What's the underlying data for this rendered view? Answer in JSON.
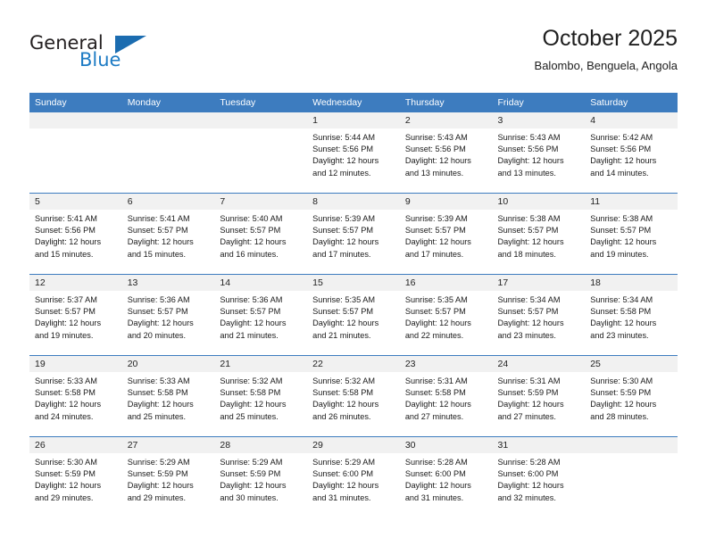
{
  "brand": {
    "word_general": "General",
    "word_blue": "Blue",
    "logo_icon": "triangle-icon"
  },
  "header": {
    "title": "October 2025",
    "subtitle": "Balombo, Benguela, Angola"
  },
  "colors": {
    "header_blue": "#3d7cbf",
    "daynum_gray": "#f1f1f1",
    "brand_blue": "#1d7bc4",
    "text": "#1a1a1a"
  },
  "weekday_headers": [
    "Sunday",
    "Monday",
    "Tuesday",
    "Wednesday",
    "Thursday",
    "Friday",
    "Saturday"
  ],
  "weeks": [
    [
      {
        "day": "",
        "details": ""
      },
      {
        "day": "",
        "details": ""
      },
      {
        "day": "",
        "details": ""
      },
      {
        "day": "1",
        "details": "Sunrise: 5:44 AM\nSunset: 5:56 PM\nDaylight: 12 hours\nand 12 minutes."
      },
      {
        "day": "2",
        "details": "Sunrise: 5:43 AM\nSunset: 5:56 PM\nDaylight: 12 hours\nand 13 minutes."
      },
      {
        "day": "3",
        "details": "Sunrise: 5:43 AM\nSunset: 5:56 PM\nDaylight: 12 hours\nand 13 minutes."
      },
      {
        "day": "4",
        "details": "Sunrise: 5:42 AM\nSunset: 5:56 PM\nDaylight: 12 hours\nand 14 minutes."
      }
    ],
    [
      {
        "day": "5",
        "details": "Sunrise: 5:41 AM\nSunset: 5:56 PM\nDaylight: 12 hours\nand 15 minutes."
      },
      {
        "day": "6",
        "details": "Sunrise: 5:41 AM\nSunset: 5:57 PM\nDaylight: 12 hours\nand 15 minutes."
      },
      {
        "day": "7",
        "details": "Sunrise: 5:40 AM\nSunset: 5:57 PM\nDaylight: 12 hours\nand 16 minutes."
      },
      {
        "day": "8",
        "details": "Sunrise: 5:39 AM\nSunset: 5:57 PM\nDaylight: 12 hours\nand 17 minutes."
      },
      {
        "day": "9",
        "details": "Sunrise: 5:39 AM\nSunset: 5:57 PM\nDaylight: 12 hours\nand 17 minutes."
      },
      {
        "day": "10",
        "details": "Sunrise: 5:38 AM\nSunset: 5:57 PM\nDaylight: 12 hours\nand 18 minutes."
      },
      {
        "day": "11",
        "details": "Sunrise: 5:38 AM\nSunset: 5:57 PM\nDaylight: 12 hours\nand 19 minutes."
      }
    ],
    [
      {
        "day": "12",
        "details": "Sunrise: 5:37 AM\nSunset: 5:57 PM\nDaylight: 12 hours\nand 19 minutes."
      },
      {
        "day": "13",
        "details": "Sunrise: 5:36 AM\nSunset: 5:57 PM\nDaylight: 12 hours\nand 20 minutes."
      },
      {
        "day": "14",
        "details": "Sunrise: 5:36 AM\nSunset: 5:57 PM\nDaylight: 12 hours\nand 21 minutes."
      },
      {
        "day": "15",
        "details": "Sunrise: 5:35 AM\nSunset: 5:57 PM\nDaylight: 12 hours\nand 21 minutes."
      },
      {
        "day": "16",
        "details": "Sunrise: 5:35 AM\nSunset: 5:57 PM\nDaylight: 12 hours\nand 22 minutes."
      },
      {
        "day": "17",
        "details": "Sunrise: 5:34 AM\nSunset: 5:57 PM\nDaylight: 12 hours\nand 23 minutes."
      },
      {
        "day": "18",
        "details": "Sunrise: 5:34 AM\nSunset: 5:58 PM\nDaylight: 12 hours\nand 23 minutes."
      }
    ],
    [
      {
        "day": "19",
        "details": "Sunrise: 5:33 AM\nSunset: 5:58 PM\nDaylight: 12 hours\nand 24 minutes."
      },
      {
        "day": "20",
        "details": "Sunrise: 5:33 AM\nSunset: 5:58 PM\nDaylight: 12 hours\nand 25 minutes."
      },
      {
        "day": "21",
        "details": "Sunrise: 5:32 AM\nSunset: 5:58 PM\nDaylight: 12 hours\nand 25 minutes."
      },
      {
        "day": "22",
        "details": "Sunrise: 5:32 AM\nSunset: 5:58 PM\nDaylight: 12 hours\nand 26 minutes."
      },
      {
        "day": "23",
        "details": "Sunrise: 5:31 AM\nSunset: 5:58 PM\nDaylight: 12 hours\nand 27 minutes."
      },
      {
        "day": "24",
        "details": "Sunrise: 5:31 AM\nSunset: 5:59 PM\nDaylight: 12 hours\nand 27 minutes."
      },
      {
        "day": "25",
        "details": "Sunrise: 5:30 AM\nSunset: 5:59 PM\nDaylight: 12 hours\nand 28 minutes."
      }
    ],
    [
      {
        "day": "26",
        "details": "Sunrise: 5:30 AM\nSunset: 5:59 PM\nDaylight: 12 hours\nand 29 minutes."
      },
      {
        "day": "27",
        "details": "Sunrise: 5:29 AM\nSunset: 5:59 PM\nDaylight: 12 hours\nand 29 minutes."
      },
      {
        "day": "28",
        "details": "Sunrise: 5:29 AM\nSunset: 5:59 PM\nDaylight: 12 hours\nand 30 minutes."
      },
      {
        "day": "29",
        "details": "Sunrise: 5:29 AM\nSunset: 6:00 PM\nDaylight: 12 hours\nand 31 minutes."
      },
      {
        "day": "30",
        "details": "Sunrise: 5:28 AM\nSunset: 6:00 PM\nDaylight: 12 hours\nand 31 minutes."
      },
      {
        "day": "31",
        "details": "Sunrise: 5:28 AM\nSunset: 6:00 PM\nDaylight: 12 hours\nand 32 minutes."
      },
      {
        "day": "",
        "details": ""
      }
    ]
  ]
}
